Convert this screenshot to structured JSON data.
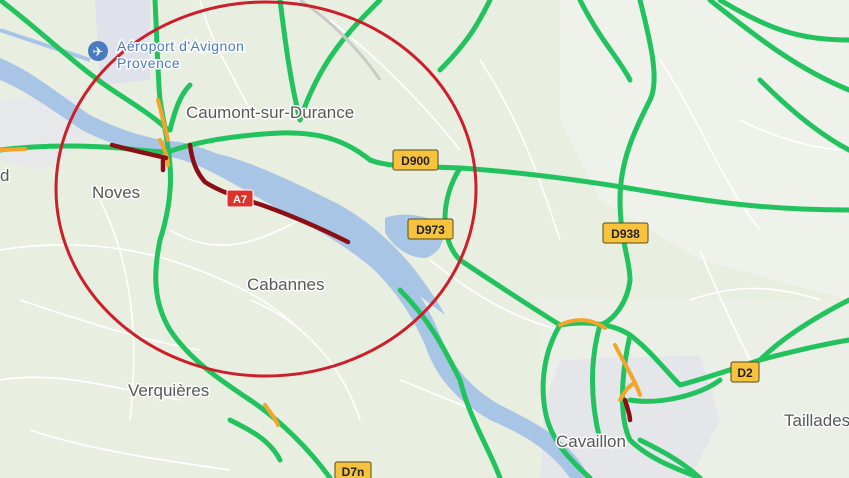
{
  "airport": {
    "label_line1": "Aéroport d'Avignon",
    "label_line2": "Provence",
    "icon": "airplane-icon"
  },
  "places": {
    "caumont": "Caumont-sur-Durance",
    "noves": "Noves",
    "cabannes": "Cabannes",
    "verquieres": "Verquières",
    "cavaillon": "Cavaillon",
    "taillades": "Taillades",
    "edge_left": "d"
  },
  "roads": {
    "a7": "A7",
    "d900": "D900",
    "d973": "D973",
    "d938": "D938",
    "d2": "D2",
    "d7n": "D7n"
  },
  "colors": {
    "land": "#e8eee0",
    "water": "#a9c5e6",
    "traffic_free": "#22c35e",
    "traffic_slow": "#f2a529",
    "traffic_jam": "#8b1016",
    "circle": "#cc1f2b",
    "shield_yellow": "#f7c33d",
    "shield_red": "#e0322c"
  }
}
